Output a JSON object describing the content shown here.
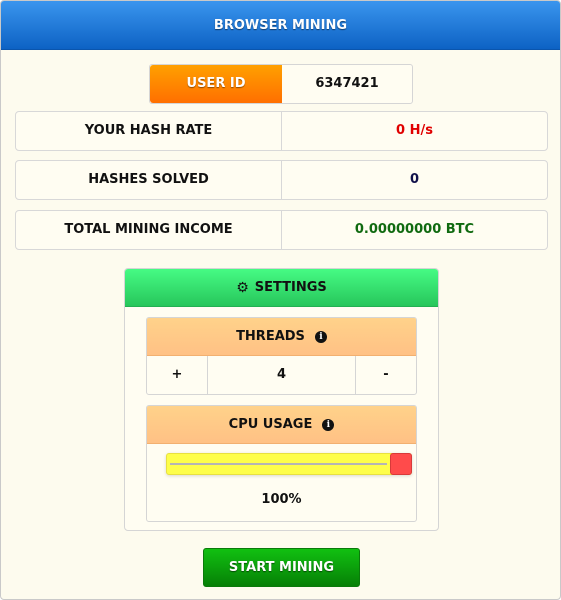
{
  "header": {
    "title": "BROWSER MINING",
    "color": "#0d62c4"
  },
  "user": {
    "label": "USER ID",
    "value": "6347421"
  },
  "stats": [
    {
      "label": "YOUR HASH RATE",
      "value": "0 H/s",
      "color": "#e00000"
    },
    {
      "label": "HASHES SOLVED",
      "value": "0",
      "color": "#10104a"
    },
    {
      "label": "TOTAL MINING INCOME",
      "value": "0.00000000 BTC",
      "color": "#106a10"
    }
  ],
  "settings": {
    "title": "SETTINGS",
    "icon": "gear-icon",
    "threads": {
      "label": "THREADS",
      "plus_label": "+",
      "value": "4",
      "minus_label": "-",
      "info_icon": "info-icon"
    },
    "cpu_usage": {
      "label": "CPU USAGE",
      "value_percent": 100,
      "value_text": "100%",
      "info_icon": "info-icon"
    }
  },
  "actions": {
    "start_label": "START MINING"
  }
}
